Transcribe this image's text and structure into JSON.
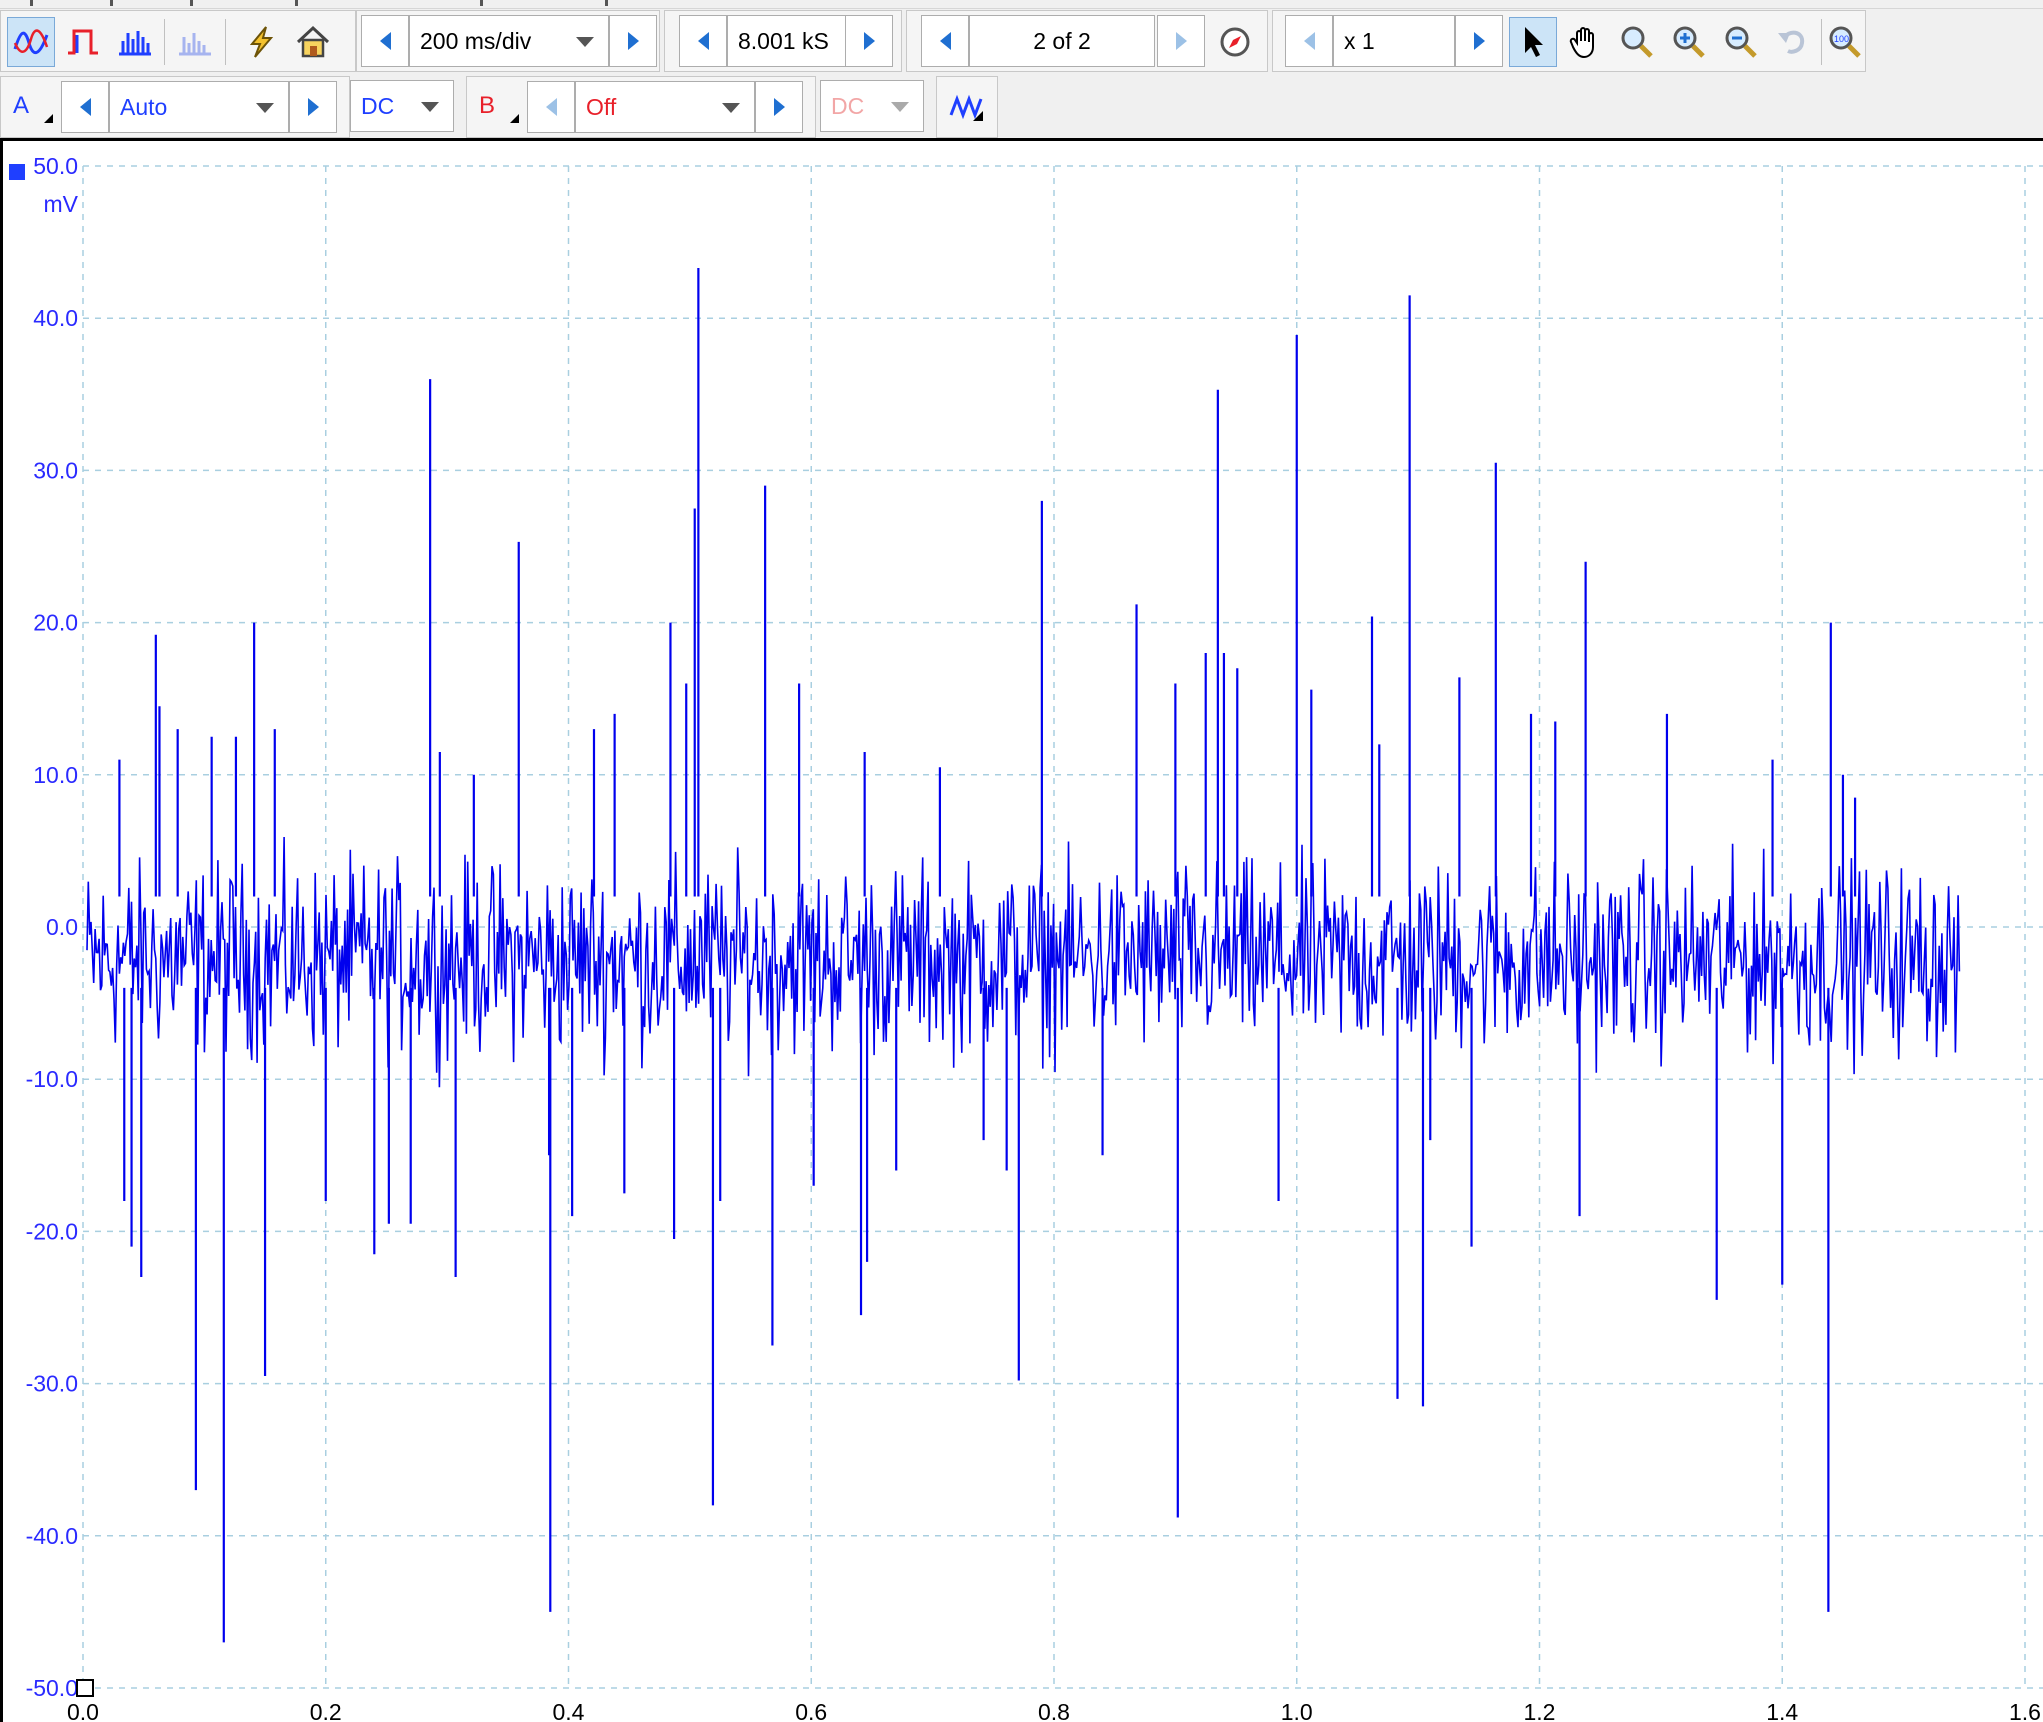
{
  "toolbar_top": {
    "timebase": "200 ms/div",
    "samples": "8.001 kS",
    "buffer": "2 of 2",
    "zoom": "x 1"
  },
  "toolbar_channels": {
    "channel_a": {
      "label": "A",
      "range": "Auto",
      "coupling": "DC",
      "color": "#1f3fff"
    },
    "channel_b": {
      "label": "B",
      "range": "Off",
      "coupling": "DC",
      "color": "#e8202a"
    }
  },
  "icons": {
    "scope_mode": "scope-mode-icon",
    "persistence_mode": "persistence-mode-icon",
    "spectrum_mode": "spectrum-mode-icon",
    "spectrum_alt": "spectrum-alt-icon",
    "auto_setup": "auto-setup-icon",
    "home": "home-icon",
    "navigate": "navigate-compass-icon",
    "select": "pointer-icon",
    "hand": "hand-pan-icon",
    "zoom": "zoom-icon",
    "zoom_in": "zoom-in-icon",
    "zoom_out": "zoom-out-icon",
    "undo_zoom": "undo-zoom-icon",
    "zoom_fit": "zoom-100-icon",
    "signal_gen": "signal-generator-icon"
  },
  "chart_data": {
    "type": "line",
    "trace_color": "#0000ee",
    "grid": true,
    "xlim": [
      0.0,
      1.6
    ],
    "ylim": [
      -50.0,
      50.0
    ],
    "y_unit": "mV",
    "y_ticks": [
      "50.0",
      "40.0",
      "30.0",
      "20.0",
      "10.0",
      "0.0",
      "-10.0",
      "-20.0",
      "-30.0",
      "-40.0",
      "-50.0"
    ],
    "x_ticks": [
      "0.0",
      "0.2",
      "0.4",
      "0.6",
      "0.8",
      "1.0",
      "1.2",
      "1.4",
      "1.6"
    ],
    "signal_end": 1.547,
    "noise_band": [
      -10,
      7
    ],
    "spikes": [
      {
        "x": 0.03,
        "y": 11
      },
      {
        "x": 0.034,
        "y": -18
      },
      {
        "x": 0.04,
        "y": -21
      },
      {
        "x": 0.048,
        "y": -23
      },
      {
        "x": 0.06,
        "y": 19.2
      },
      {
        "x": 0.063,
        "y": 14.5
      },
      {
        "x": 0.078,
        "y": 13
      },
      {
        "x": 0.093,
        "y": -37
      },
      {
        "x": 0.106,
        "y": 12.5
      },
      {
        "x": 0.116,
        "y": -47
      },
      {
        "x": 0.126,
        "y": 12.5
      },
      {
        "x": 0.141,
        "y": 20
      },
      {
        "x": 0.15,
        "y": -29.5
      },
      {
        "x": 0.158,
        "y": 13
      },
      {
        "x": 0.2,
        "y": -18
      },
      {
        "x": 0.24,
        "y": -21.5
      },
      {
        "x": 0.252,
        "y": -19.5
      },
      {
        "x": 0.27,
        "y": -19.5
      },
      {
        "x": 0.286,
        "y": 36
      },
      {
        "x": 0.294,
        "y": 11.5
      },
      {
        "x": 0.307,
        "y": -23
      },
      {
        "x": 0.322,
        "y": 10
      },
      {
        "x": 0.359,
        "y": 25.3
      },
      {
        "x": 0.384,
        "y": -15
      },
      {
        "x": 0.385,
        "y": -45
      },
      {
        "x": 0.403,
        "y": -19
      },
      {
        "x": 0.421,
        "y": 13
      },
      {
        "x": 0.438,
        "y": 14
      },
      {
        "x": 0.446,
        "y": -17.5
      },
      {
        "x": 0.484,
        "y": 20
      },
      {
        "x": 0.487,
        "y": -20.5
      },
      {
        "x": 0.497,
        "y": 16
      },
      {
        "x": 0.504,
        "y": 27.5
      },
      {
        "x": 0.507,
        "y": 43.3
      },
      {
        "x": 0.519,
        "y": -38
      },
      {
        "x": 0.525,
        "y": -18
      },
      {
        "x": 0.562,
        "y": 29
      },
      {
        "x": 0.568,
        "y": -27.5
      },
      {
        "x": 0.59,
        "y": 16
      },
      {
        "x": 0.602,
        "y": -17
      },
      {
        "x": 0.641,
        "y": -25.5
      },
      {
        "x": 0.644,
        "y": 11.5
      },
      {
        "x": 0.646,
        "y": -22
      },
      {
        "x": 0.67,
        "y": -16
      },
      {
        "x": 0.706,
        "y": 10.5
      },
      {
        "x": 0.742,
        "y": -14
      },
      {
        "x": 0.761,
        "y": -16
      },
      {
        "x": 0.771,
        "y": -29.8
      },
      {
        "x": 0.79,
        "y": 28
      },
      {
        "x": 0.84,
        "y": -15
      },
      {
        "x": 0.868,
        "y": 21.2
      },
      {
        "x": 0.9,
        "y": 16
      },
      {
        "x": 0.902,
        "y": -38.8
      },
      {
        "x": 0.925,
        "y": 18
      },
      {
        "x": 0.935,
        "y": 35.3
      },
      {
        "x": 0.94,
        "y": 18
      },
      {
        "x": 0.951,
        "y": 17
      },
      {
        "x": 0.985,
        "y": -18
      },
      {
        "x": 1.0,
        "y": 38.9
      },
      {
        "x": 1.012,
        "y": 15.6
      },
      {
        "x": 1.062,
        "y": 20.4
      },
      {
        "x": 1.068,
        "y": 12
      },
      {
        "x": 1.083,
        "y": -31
      },
      {
        "x": 1.093,
        "y": 41.5
      },
      {
        "x": 1.104,
        "y": -31.5
      },
      {
        "x": 1.11,
        "y": -14
      },
      {
        "x": 1.134,
        "y": 16.4
      },
      {
        "x": 1.144,
        "y": -21
      },
      {
        "x": 1.164,
        "y": 30.5
      },
      {
        "x": 1.193,
        "y": 14
      },
      {
        "x": 1.213,
        "y": 13.5
      },
      {
        "x": 1.233,
        "y": -19
      },
      {
        "x": 1.238,
        "y": 24
      },
      {
        "x": 1.305,
        "y": 14
      },
      {
        "x": 1.346,
        "y": -24.5
      },
      {
        "x": 1.392,
        "y": 11
      },
      {
        "x": 1.4,
        "y": -23.5
      },
      {
        "x": 1.438,
        "y": -45
      },
      {
        "x": 1.44,
        "y": 20
      },
      {
        "x": 1.45,
        "y": 10
      },
      {
        "x": 1.46,
        "y": 8.5
      }
    ]
  }
}
